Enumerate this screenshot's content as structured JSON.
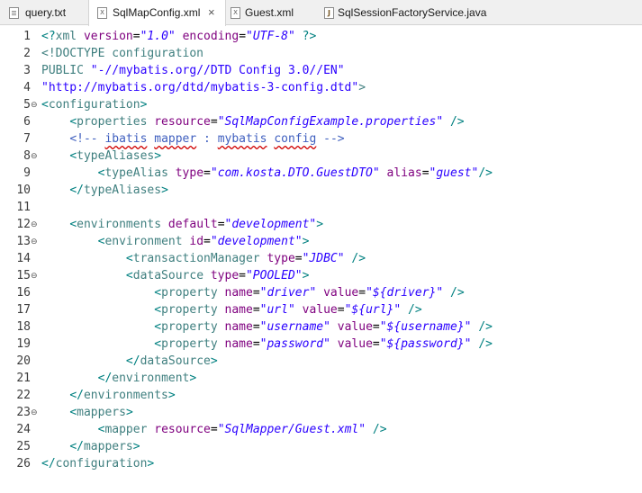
{
  "tabs": [
    {
      "label": "query.txt",
      "icon": "txt-file-icon",
      "active": false
    },
    {
      "label": "SqlMapConfig.xml",
      "icon": "xml-file-icon",
      "active": true
    },
    {
      "label": "Guest.xml",
      "icon": "xml-file-icon",
      "active": false
    },
    {
      "label": "SqlSessionFactoryService.java",
      "icon": "java-file-icon",
      "active": false
    }
  ],
  "close_glyph": "×",
  "fold_glyph": "⊖",
  "lines": [
    {
      "n": "1",
      "segs": [
        [
          "bracket",
          "<?"
        ],
        [
          "tag",
          "xml "
        ],
        [
          "attr",
          "version"
        ],
        [
          "plain",
          "="
        ],
        [
          "val",
          "\"1.0\""
        ],
        [
          "plain",
          " "
        ],
        [
          "attr",
          "encoding"
        ],
        [
          "plain",
          "="
        ],
        [
          "val",
          "\"UTF-8\""
        ],
        [
          "plain",
          " "
        ],
        [
          "bracket",
          "?>"
        ]
      ]
    },
    {
      "n": "2",
      "segs": [
        [
          "doctype",
          "<!DOCTYPE configuration"
        ]
      ]
    },
    {
      "n": "3",
      "segs": [
        [
          "doctype",
          "PUBLIC "
        ],
        [
          "pubid",
          "\"-//mybatis.org//DTD Config 3.0//EN\""
        ]
      ]
    },
    {
      "n": "4",
      "segs": [
        [
          "pubid",
          "\"http://mybatis.org/dtd/mybatis-3-config.dtd\""
        ],
        [
          "doctype",
          ">"
        ]
      ]
    },
    {
      "n": "5",
      "fold": true,
      "segs": [
        [
          "bracket",
          "<"
        ],
        [
          "tag",
          "configuration"
        ],
        [
          "bracket",
          ">"
        ]
      ]
    },
    {
      "n": "6",
      "segs": [
        [
          "plain",
          "    "
        ],
        [
          "bracket",
          "<"
        ],
        [
          "tag",
          "properties "
        ],
        [
          "attr",
          "resource"
        ],
        [
          "plain",
          "="
        ],
        [
          "val",
          "\"SqlMapConfigExample.properties\""
        ],
        [
          "plain",
          " "
        ],
        [
          "bracket",
          "/>"
        ]
      ]
    },
    {
      "n": "7",
      "segs": [
        [
          "plain",
          "    "
        ],
        [
          "comment",
          "<!-- "
        ],
        [
          "commentsq",
          "ibatis"
        ],
        [
          "comment",
          " "
        ],
        [
          "commentsq",
          "mapper"
        ],
        [
          "comment",
          " : "
        ],
        [
          "commentsq",
          "mybatis"
        ],
        [
          "comment",
          " "
        ],
        [
          "commentsq",
          "config"
        ],
        [
          "comment",
          " -->"
        ]
      ]
    },
    {
      "n": "8",
      "fold": true,
      "segs": [
        [
          "plain",
          "    "
        ],
        [
          "bracket",
          "<"
        ],
        [
          "tag",
          "typeAliases"
        ],
        [
          "bracket",
          ">"
        ]
      ]
    },
    {
      "n": "9",
      "segs": [
        [
          "plain",
          "        "
        ],
        [
          "bracket",
          "<"
        ],
        [
          "tag",
          "typeAlias "
        ],
        [
          "attr",
          "type"
        ],
        [
          "plain",
          "="
        ],
        [
          "val",
          "\"com.kosta.DTO.GuestDTO\""
        ],
        [
          "plain",
          " "
        ],
        [
          "attr",
          "alias"
        ],
        [
          "plain",
          "="
        ],
        [
          "val",
          "\"guest\""
        ],
        [
          "bracket",
          "/>"
        ]
      ]
    },
    {
      "n": "10",
      "segs": [
        [
          "plain",
          "    "
        ],
        [
          "bracket",
          "</"
        ],
        [
          "tag",
          "typeAliases"
        ],
        [
          "bracket",
          ">"
        ]
      ]
    },
    {
      "n": "11",
      "segs": []
    },
    {
      "n": "12",
      "fold": true,
      "segs": [
        [
          "plain",
          "    "
        ],
        [
          "bracket",
          "<"
        ],
        [
          "tag",
          "environments "
        ],
        [
          "attr",
          "default"
        ],
        [
          "plain",
          "="
        ],
        [
          "val",
          "\"development\""
        ],
        [
          "bracket",
          ">"
        ]
      ]
    },
    {
      "n": "13",
      "fold": true,
      "segs": [
        [
          "plain",
          "        "
        ],
        [
          "bracket",
          "<"
        ],
        [
          "tag",
          "environment "
        ],
        [
          "attr",
          "id"
        ],
        [
          "plain",
          "="
        ],
        [
          "val",
          "\"development\""
        ],
        [
          "bracket",
          ">"
        ]
      ]
    },
    {
      "n": "14",
      "segs": [
        [
          "plain",
          "            "
        ],
        [
          "bracket",
          "<"
        ],
        [
          "tag",
          "transactionManager "
        ],
        [
          "attr",
          "type"
        ],
        [
          "plain",
          "="
        ],
        [
          "val",
          "\"JDBC\""
        ],
        [
          "plain",
          " "
        ],
        [
          "bracket",
          "/>"
        ]
      ]
    },
    {
      "n": "15",
      "fold": true,
      "segs": [
        [
          "plain",
          "            "
        ],
        [
          "bracket",
          "<"
        ],
        [
          "tag",
          "dataSource "
        ],
        [
          "attr",
          "type"
        ],
        [
          "plain",
          "="
        ],
        [
          "val",
          "\"POOLED\""
        ],
        [
          "bracket",
          ">"
        ]
      ]
    },
    {
      "n": "16",
      "segs": [
        [
          "plain",
          "                "
        ],
        [
          "bracket",
          "<"
        ],
        [
          "tag",
          "property "
        ],
        [
          "attr",
          "name"
        ],
        [
          "plain",
          "="
        ],
        [
          "val",
          "\"driver\""
        ],
        [
          "plain",
          " "
        ],
        [
          "attr",
          "value"
        ],
        [
          "plain",
          "="
        ],
        [
          "val",
          "\"${driver}\""
        ],
        [
          "plain",
          " "
        ],
        [
          "bracket",
          "/>"
        ]
      ]
    },
    {
      "n": "17",
      "segs": [
        [
          "plain",
          "                "
        ],
        [
          "bracket",
          "<"
        ],
        [
          "tag",
          "property "
        ],
        [
          "attr",
          "name"
        ],
        [
          "plain",
          "="
        ],
        [
          "val",
          "\"url\""
        ],
        [
          "plain",
          " "
        ],
        [
          "attr",
          "value"
        ],
        [
          "plain",
          "="
        ],
        [
          "val",
          "\"${url}\""
        ],
        [
          "plain",
          " "
        ],
        [
          "bracket",
          "/>"
        ]
      ]
    },
    {
      "n": "18",
      "segs": [
        [
          "plain",
          "                "
        ],
        [
          "bracket",
          "<"
        ],
        [
          "tag",
          "property "
        ],
        [
          "attr",
          "name"
        ],
        [
          "plain",
          "="
        ],
        [
          "val",
          "\"username\""
        ],
        [
          "plain",
          " "
        ],
        [
          "attr",
          "value"
        ],
        [
          "plain",
          "="
        ],
        [
          "val",
          "\"${username}\""
        ],
        [
          "plain",
          " "
        ],
        [
          "bracket",
          "/>"
        ]
      ]
    },
    {
      "n": "19",
      "segs": [
        [
          "plain",
          "                "
        ],
        [
          "bracket",
          "<"
        ],
        [
          "tag",
          "property "
        ],
        [
          "attr",
          "name"
        ],
        [
          "plain",
          "="
        ],
        [
          "val",
          "\"password\""
        ],
        [
          "plain",
          " "
        ],
        [
          "attr",
          "value"
        ],
        [
          "plain",
          "="
        ],
        [
          "val",
          "\"${password}\""
        ],
        [
          "plain",
          " "
        ],
        [
          "bracket",
          "/>"
        ]
      ]
    },
    {
      "n": "20",
      "segs": [
        [
          "plain",
          "            "
        ],
        [
          "bracket",
          "</"
        ],
        [
          "tag",
          "dataSource"
        ],
        [
          "bracket",
          ">"
        ]
      ]
    },
    {
      "n": "21",
      "segs": [
        [
          "plain",
          "        "
        ],
        [
          "bracket",
          "</"
        ],
        [
          "tag",
          "environment"
        ],
        [
          "bracket",
          ">"
        ]
      ]
    },
    {
      "n": "22",
      "segs": [
        [
          "plain",
          "    "
        ],
        [
          "bracket",
          "</"
        ],
        [
          "tag",
          "environments"
        ],
        [
          "bracket",
          ">"
        ]
      ]
    },
    {
      "n": "23",
      "fold": true,
      "segs": [
        [
          "plain",
          "    "
        ],
        [
          "bracket",
          "<"
        ],
        [
          "tag",
          "mappers"
        ],
        [
          "bracket",
          ">"
        ]
      ]
    },
    {
      "n": "24",
      "segs": [
        [
          "plain",
          "        "
        ],
        [
          "bracket",
          "<"
        ],
        [
          "tag",
          "mapper "
        ],
        [
          "attr",
          "resource"
        ],
        [
          "plain",
          "="
        ],
        [
          "val",
          "\"SqlMapper/Guest.xml\""
        ],
        [
          "plain",
          " "
        ],
        [
          "bracket",
          "/>"
        ]
      ]
    },
    {
      "n": "25",
      "segs": [
        [
          "plain",
          "    "
        ],
        [
          "bracket",
          "</"
        ],
        [
          "tag",
          "mappers"
        ],
        [
          "bracket",
          ">"
        ]
      ]
    },
    {
      "n": "26",
      "segs": [
        [
          "bracket",
          "</"
        ],
        [
          "tag",
          "configuration"
        ],
        [
          "bracket",
          ">"
        ]
      ]
    }
  ]
}
